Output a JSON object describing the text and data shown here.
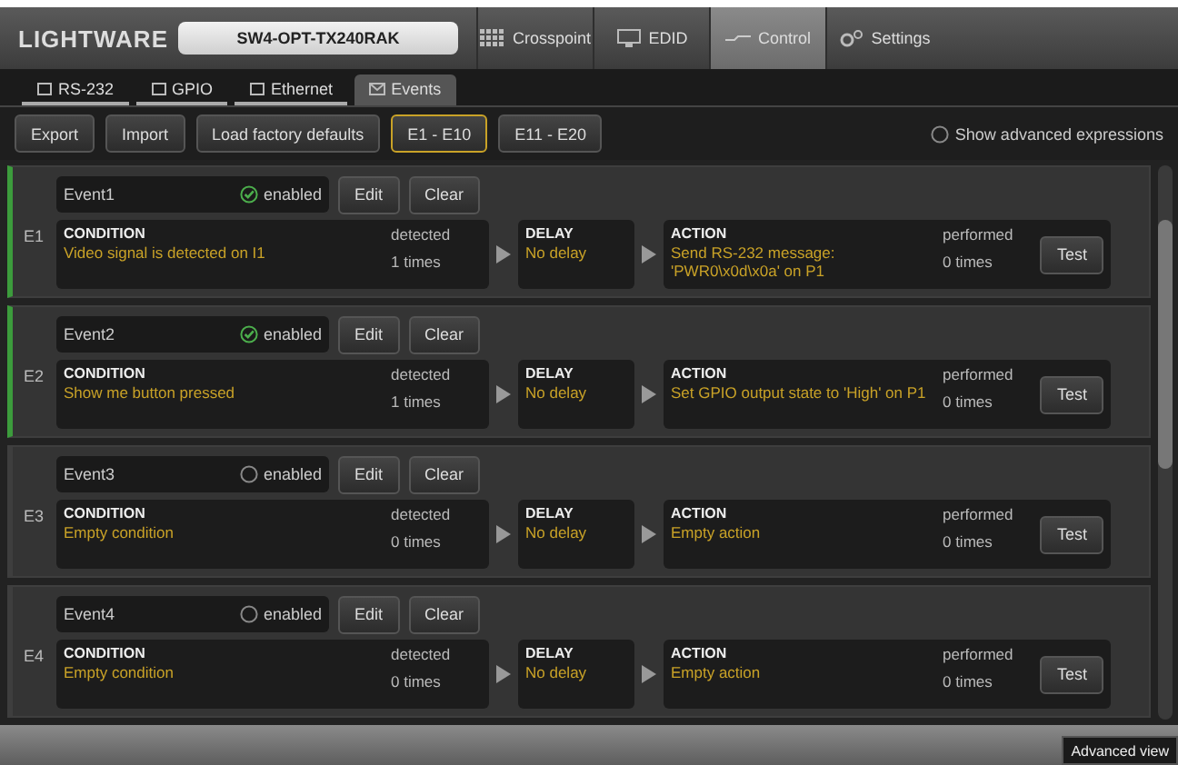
{
  "header": {
    "logo": "LIGHTWARE",
    "device": "SW4-OPT-TX240RAK",
    "tabs": [
      {
        "label": "Crosspoint",
        "kind": "grid",
        "selected": false
      },
      {
        "label": "EDID",
        "kind": "monitor",
        "selected": false
      },
      {
        "label": "Control",
        "kind": "cable",
        "selected": true
      },
      {
        "label": "Settings",
        "kind": "gear",
        "selected": false
      }
    ]
  },
  "subtabs": [
    {
      "label": "RS-232",
      "selected": false
    },
    {
      "label": "GPIO",
      "selected": false
    },
    {
      "label": "Ethernet",
      "selected": false
    },
    {
      "label": "Events",
      "selected": true
    }
  ],
  "toolbar": {
    "buttons": [
      "Export",
      "Import",
      "Load factory defaults"
    ],
    "pages": [
      {
        "label": "E1 - E10",
        "selected": true
      },
      {
        "label": "E11 - E20",
        "selected": false
      }
    ],
    "advanced": {
      "label": "Show advanced expressions",
      "checked": false
    }
  },
  "events": [
    {
      "id": "E1",
      "name": "Event1",
      "enabled": true,
      "enabled_label": "enabled",
      "edit": "Edit",
      "clear": "Clear",
      "condition_title": "CONDITION",
      "condition": "Video signal is detected on I1",
      "detected": "detected",
      "detected_count": "1 times",
      "delay_title": "DELAY",
      "delay": "No delay",
      "action_title": "ACTION",
      "action": "Send RS-232 message: 'PWR0\\x0d\\x0a' on P1",
      "performed": "performed",
      "performed_count": "0 times",
      "test": "Test"
    },
    {
      "id": "E2",
      "name": "Event2",
      "enabled": true,
      "enabled_label": "enabled",
      "edit": "Edit",
      "clear": "Clear",
      "condition_title": "CONDITION",
      "condition": "Show me button pressed",
      "detected": "detected",
      "detected_count": "1 times",
      "delay_title": "DELAY",
      "delay": "No delay",
      "action_title": "ACTION",
      "action": "Set GPIO output state to 'High' on P1",
      "performed": "performed",
      "performed_count": "0 times",
      "test": "Test"
    },
    {
      "id": "E3",
      "name": "Event3",
      "enabled": false,
      "enabled_label": "enabled",
      "edit": "Edit",
      "clear": "Clear",
      "condition_title": "CONDITION",
      "condition": "Empty condition",
      "detected": "detected",
      "detected_count": "0 times",
      "delay_title": "DELAY",
      "delay": "No delay",
      "action_title": "ACTION",
      "action": "Empty action",
      "performed": "performed",
      "performed_count": "0 times",
      "test": "Test"
    },
    {
      "id": "E4",
      "name": "Event4",
      "enabled": false,
      "enabled_label": "enabled",
      "edit": "Edit",
      "clear": "Clear",
      "condition_title": "CONDITION",
      "condition": "Empty condition",
      "detected": "detected",
      "detected_count": "0 times",
      "delay_title": "DELAY",
      "delay": "No delay",
      "action_title": "ACTION",
      "action": "Empty action",
      "performed": "performed",
      "performed_count": "0 times",
      "test": "Test"
    }
  ],
  "footer": {
    "advanced_view": "Advanced view"
  }
}
